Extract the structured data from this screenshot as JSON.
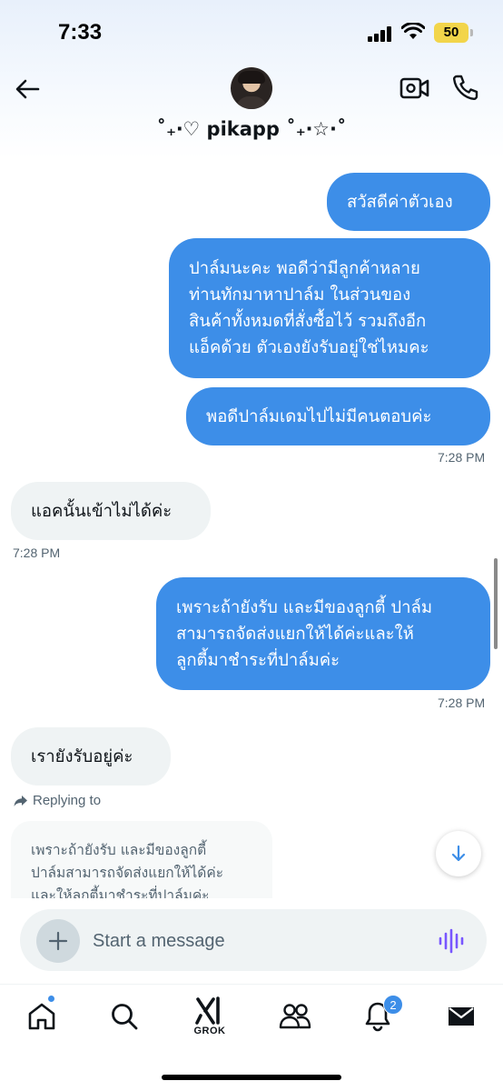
{
  "status_bar": {
    "time": "7:33",
    "battery": "50"
  },
  "header": {
    "contact_name": "˚₊‧♡ pikapp ˚₊‧☆·˚"
  },
  "messages": [
    {
      "direction": "out",
      "text": "สวัสดีค่าตัวเอง"
    },
    {
      "direction": "out",
      "lines": [
        "ปาล์มนะคะ พอดีว่ามีลูกค้าหลาย",
        "ท่านทักมาหาปาล์ม ในส่วนของ",
        "สินค้าทั้งหมดที่สั่งซื้อไว้ รวมถึงอีก",
        "แอ็คด้วย ตัวเองยังรับอยู่ใช่ไหมคะ"
      ]
    },
    {
      "direction": "out",
      "text": "พอดีปาล์มเดมไปไม่มีคนตอบค่ะ",
      "time": "7:28 PM"
    },
    {
      "direction": "in",
      "text": "แอคนั้นเข้าไม่ได้ค่ะ",
      "time": "7:28 PM"
    },
    {
      "direction": "out",
      "lines": [
        "เพราะถ้ายังรับ และมีของลูกตี้ ปาล์ม",
        "สามารถจัดส่งแยกให้ได้ค่ะและให้",
        "ลูกตี้มาชำระที่ปาล์มค่ะ"
      ],
      "time": "7:28 PM"
    },
    {
      "direction": "in",
      "text": "เรายังรับอยู่ค่ะ"
    }
  ],
  "reply": {
    "label": "Replying to",
    "quoted_lines": [
      "เพราะถ้ายังรับ และมีของลูกตี้",
      "ปาล์มสามารถจัดส่งแยกให้ได้ค่ะ",
      "และให้ลูกตี้มาชำระที่ปาล์มค่ะ"
    ]
  },
  "composer": {
    "placeholder": "Start a message"
  },
  "tabbar": {
    "grok_label": "GROK",
    "notifications_count": "2"
  },
  "colors": {
    "accent": "#3d8ee8",
    "incoming_bubble": "#eff3f4",
    "voice_icon": "#7856ff"
  },
  "icons": [
    "back-arrow-icon",
    "video-camera-icon",
    "phone-icon",
    "plus-icon",
    "voice-wave-icon",
    "arrow-down-icon",
    "home-icon",
    "search-icon",
    "grok-icon",
    "communities-icon",
    "bell-icon",
    "mail-icon",
    "reply-arrow-icon"
  ]
}
